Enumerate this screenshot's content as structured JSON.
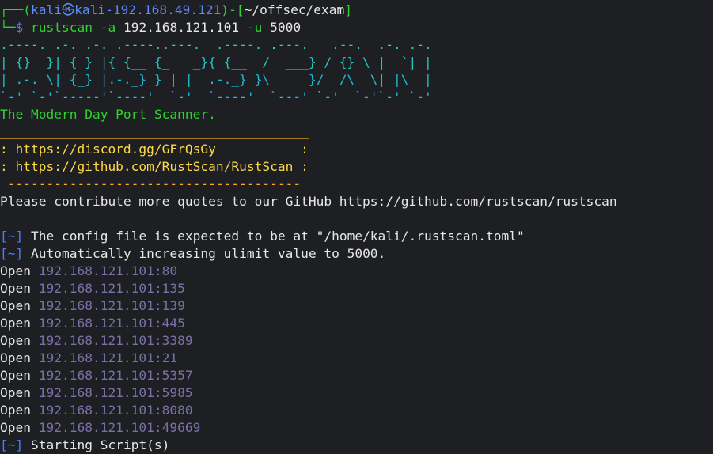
{
  "prompt": {
    "corner_top": "┌──",
    "open": "(",
    "user": "kali",
    "at_icon": "㉿",
    "host": "kali-192.168.49.121",
    "close": ")-[",
    "path": "~/offsec/exam",
    "bracket_close": "]",
    "corner_bottom": "└─",
    "dollar": "$",
    "command": "rustscan",
    "flag_a": "-a",
    "target": "192.168.121.101",
    "flag_u": "-u",
    "ulimit": "5000"
  },
  "banner": {
    "art": [
      ".----. .-. .-. .----..---.  .----. .---.   .--.  .-. .-.",
      "| {}  }| { } |{ {__ {_   _}{ {__  /  ___} / {} \\ |  `| |",
      "| .-. \\| {_} |.-._} } | |  .-._} }\\     }/  /\\  \\| |\\  |",
      "`-' `-'`-----'`----'  `-'  `----'  `---' `-'  `-'`-' `-'"
    ],
    "tagline": "The Modern Day Port Scanner."
  },
  "info_box": {
    "top_rule": "________________________________________",
    "discord": ": https://discord.gg/GFrQsGy           :",
    "github": ": https://github.com/RustScan/RustScan :",
    "bottom_rule": " --------------------------------------"
  },
  "quote": "Please contribute more quotes to our GitHub https://github.com/rustscan/rustscan",
  "messages": [
    {
      "tag": "[~]",
      "text": "The config file is expected to be at \"/home/kali/.rustscan.toml\""
    },
    {
      "tag": "[~]",
      "text": "Automatically increasing ulimit value to 5000."
    }
  ],
  "open_ports": [
    {
      "label": "Open",
      "address": "192.168.121.101:80"
    },
    {
      "label": "Open",
      "address": "192.168.121.101:135"
    },
    {
      "label": "Open",
      "address": "192.168.121.101:139"
    },
    {
      "label": "Open",
      "address": "192.168.121.101:445"
    },
    {
      "label": "Open",
      "address": "192.168.121.101:3389"
    },
    {
      "label": "Open",
      "address": "192.168.121.101:21"
    },
    {
      "label": "Open",
      "address": "192.168.121.101:5357"
    },
    {
      "label": "Open",
      "address": "192.168.121.101:5985"
    },
    {
      "label": "Open",
      "address": "192.168.121.101:8080"
    },
    {
      "label": "Open",
      "address": "192.168.121.101:49669"
    }
  ],
  "partial_line": {
    "tag": "[~]",
    "text": "Starting Script(s)"
  },
  "colors": {
    "background": "#1e1f22",
    "prompt_green": "#2fd32f",
    "prompt_blue": "#5b8cff",
    "banner_link_yellow": "#ffd945",
    "port_address": "#7a71a8",
    "separator_rule": "#ffa726"
  }
}
